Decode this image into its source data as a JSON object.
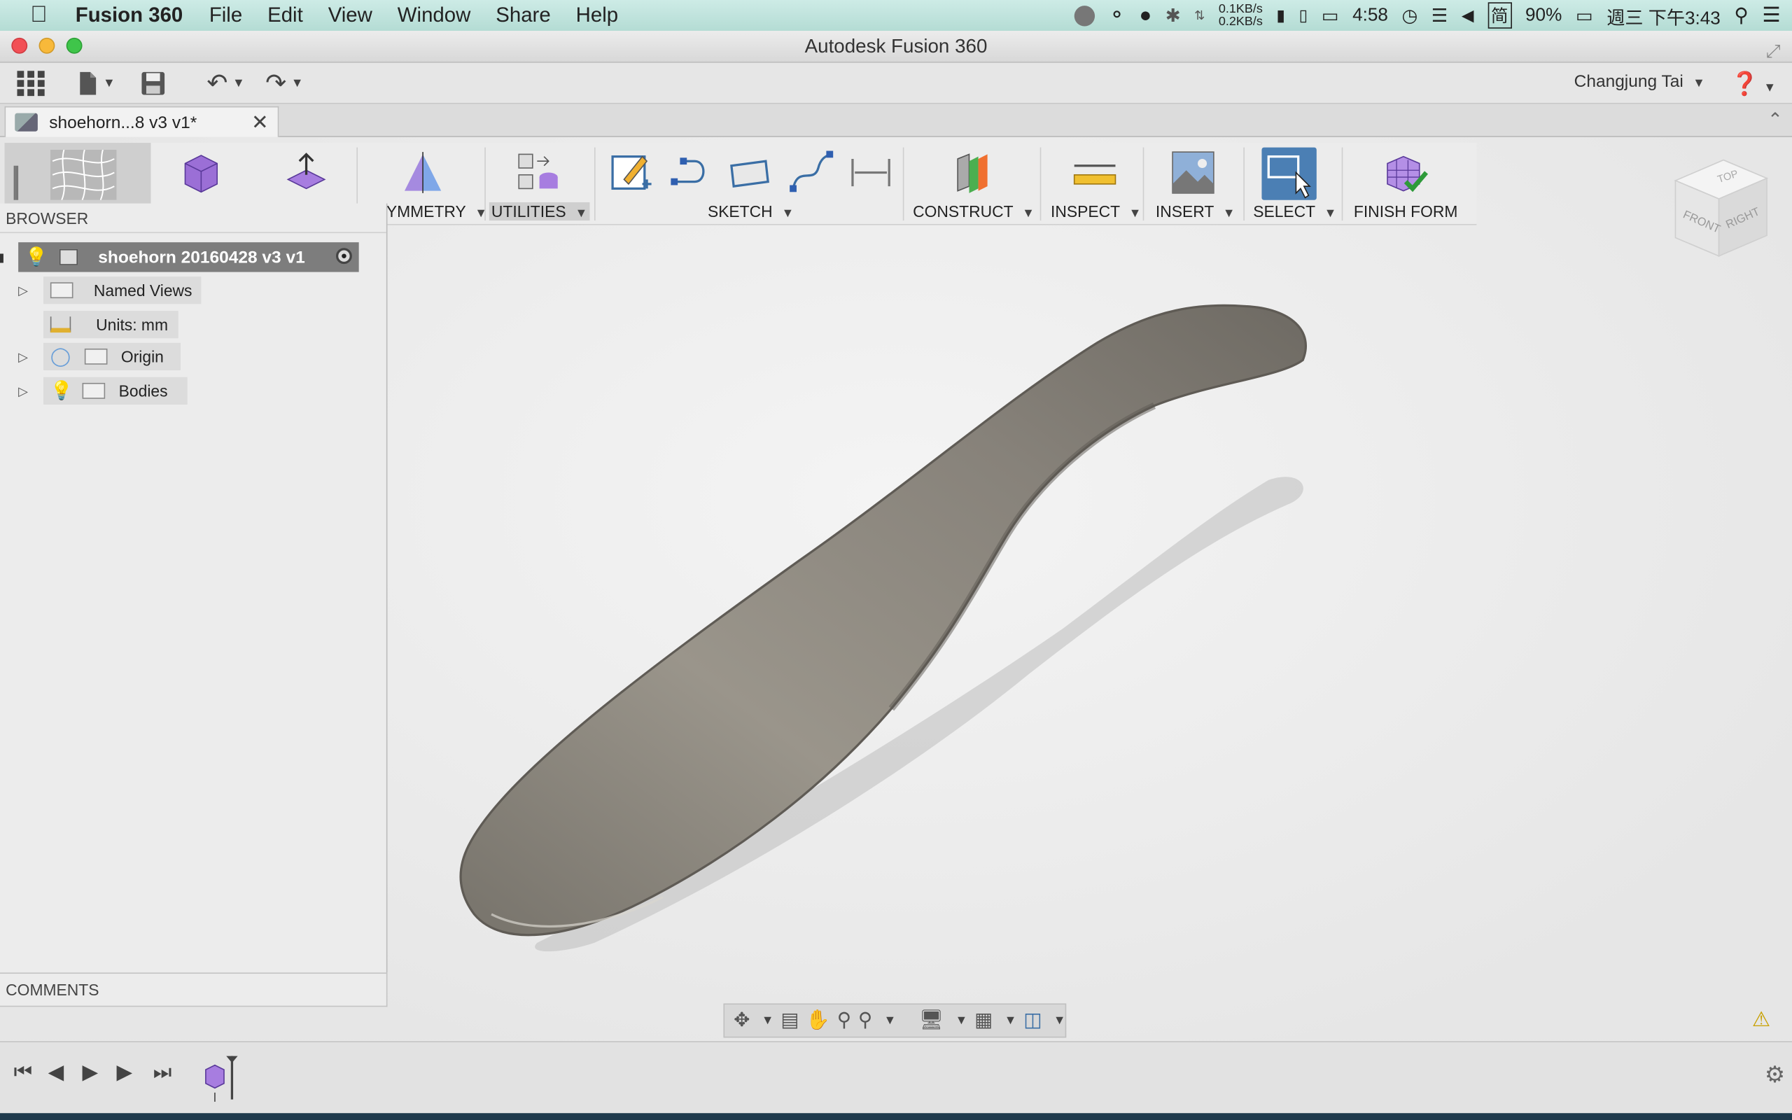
{
  "menubar": {
    "app_name": "Fusion 360",
    "menus": [
      "File",
      "Edit",
      "View",
      "Window",
      "Share",
      "Help"
    ],
    "net_up": "0.1KB/s",
    "net_down": "0.2KB/s",
    "battery_time": "4:58",
    "battery_percent": "90%",
    "clock": "週三 下午3:43"
  },
  "window": {
    "title": "Autodesk Fusion 360"
  },
  "qat": {
    "user_name": "Changjung Tai"
  },
  "document_tab": {
    "label": "shoehorn...8 v3 v1*"
  },
  "ribbon": {
    "groups": {
      "symmetry": "YMMETRY",
      "utilities": "UTILITIES",
      "sketch": "SKETCH",
      "construct": "CONSTRUCT",
      "inspect": "INSPECT",
      "insert": "INSERT",
      "select": "SELECT",
      "finish_form": "FINISH FORM"
    }
  },
  "viewcube": {
    "top": "TOP",
    "front": "FRONT",
    "right": "RIGHT"
  },
  "browser": {
    "header": "BROWSER",
    "root": "shoehorn 20160428 v3 v1",
    "nodes": {
      "named_views": "Named Views",
      "units": "Units: mm",
      "origin": "Origin",
      "bodies": "Bodies"
    }
  },
  "comments": {
    "header": "COMMENTS"
  },
  "colors": {
    "accent": "#4b7fb4",
    "menubar": "#c3e4de",
    "model": "#8f8a80"
  }
}
